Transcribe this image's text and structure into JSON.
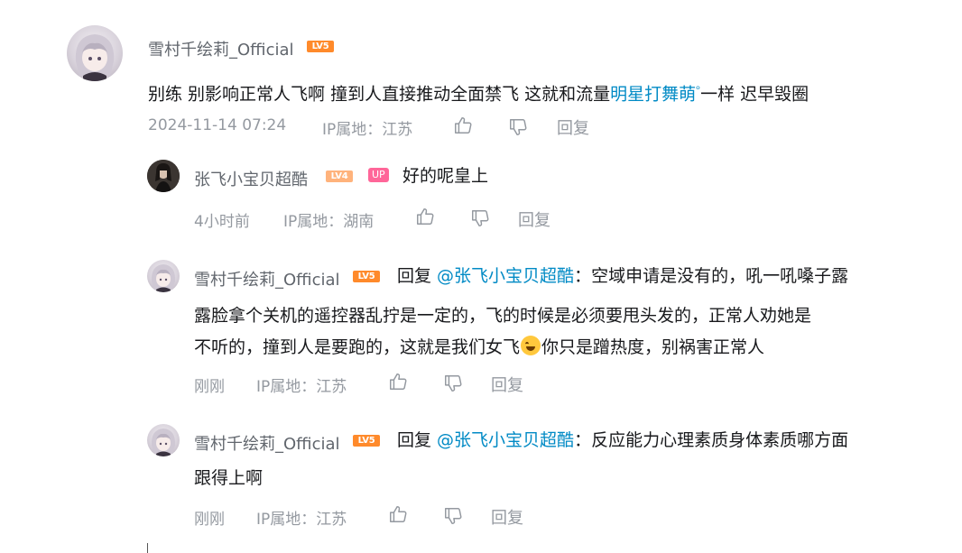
{
  "comment": {
    "username": "雪村千绘莉_Official",
    "level": "LV5",
    "text_before": "别练 别影响正常人飞啊 撞到人直接推动全面禁飞 这就和流量",
    "link": "明星打舞萌",
    "search_glyph": "ᵒ",
    "text_after": "一样 迟早毁圈",
    "time": "2024-11-14 07:24",
    "ip": "IP属地：江苏",
    "reply_label": "回复"
  },
  "replies": [
    {
      "username": "张飞小宝贝超酷",
      "level": "LV4",
      "up_badge": "UP",
      "text": "好的呢皇上",
      "time": "4小时前",
      "ip": "IP属地：湖南",
      "reply_label": "回复"
    },
    {
      "username": "雪村千绘莉_Official",
      "level": "LV5",
      "reply_prefix": "回复 ",
      "mention": "@张飞小宝贝超酷",
      "line1": "：空域申请是没有的，吼一吼嗓子露",
      "line2": "露脸拿个关机的遥控器乱拧是一定的，飞的时候是必须要甩头发的，正常人劝她是",
      "line3a": "不听的，撞到人是要跑的，这就是我们女飞",
      "line3b": "你只是蹭热度，别祸害正常人",
      "time": "刚刚",
      "ip": "IP属地：江苏",
      "reply_label": "回复"
    },
    {
      "username": "雪村千绘莉_Official",
      "level": "LV5",
      "reply_prefix": "回复 ",
      "mention": "@张飞小宝贝超酷",
      "line1": "：反应能力心理素质身体素质哪方面",
      "line2": "跟得上啊",
      "time": "刚刚",
      "ip": "IP属地：江苏",
      "reply_label": "回复"
    }
  ],
  "colors": {
    "link": "#008ac5",
    "level5": "#ff8a2b",
    "level4": "#ffb37c",
    "up_badge": "#ff6699",
    "meta": "#9499a0"
  }
}
